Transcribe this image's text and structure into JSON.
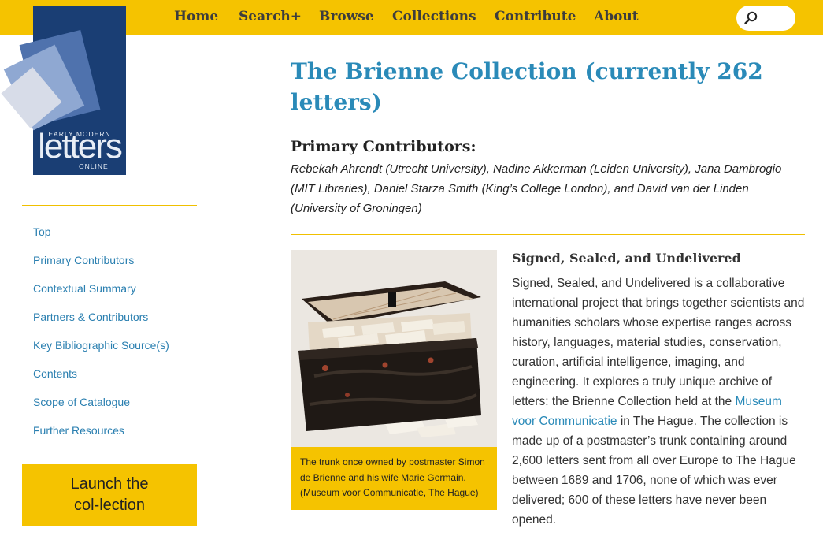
{
  "nav": {
    "items": [
      "Home",
      "Search+",
      "Browse",
      "Collections",
      "Contribute",
      "About"
    ],
    "search_placeholder": ""
  },
  "logo": {
    "line1": "EARLY MODERN",
    "line2": "letters",
    "line3": "ONLINE"
  },
  "sidebar": {
    "links": [
      "Top",
      "Primary Contributors",
      "Contextual Summary",
      "Partners & Contributors",
      "Key Bibliographic Source(s)",
      "Contents",
      "Scope of Catalogue",
      "Further Resources"
    ],
    "launch_label": "Launch the col-lection"
  },
  "main": {
    "title": "The Brienne Collection (currently 262 letters)",
    "contributors_heading": "Primary Contributors:",
    "contributors_text": "Rebekah Ahrendt (Utrecht University), Nadine Akkerman (Leiden University), Jana Dambrogio (MIT Libraries), Daniel Starza Smith (King’s College London), and David van der Linden (University of Groningen)",
    "image_caption": "The trunk once owned by postmaster Simon de Brienne and his wife Marie Germain. (Museum voor Communicatie, The Hague)",
    "article_heading": "Signed, Sealed, and Undelivered",
    "article_text_1": "Signed, Sealed, and Undelivered is a collaborative international project that brings together scientists and humanities scholars whose expertise ranges across history, languages, material studies, conservation, curation, artificial intelligence, imaging, and engineering. It explores a truly unique archive of letters: the Brienne Collection held at the ",
    "article_link": "Museum voor Communicatie",
    "article_text_2": " in The Hague. The collection is made up of a postmaster’s trunk containing around 2,600 letters sent from all over Europe to The Hague between 1689 and 1706, none of which was ever delivered; 600 of these letters have never been opened."
  },
  "colors": {
    "accent_yellow": "#f5c300",
    "link_blue": "#2a7fb0",
    "title_blue": "#2a8ab8",
    "logo_navy": "#1a3e74"
  },
  "icons": [
    "search-icon"
  ]
}
